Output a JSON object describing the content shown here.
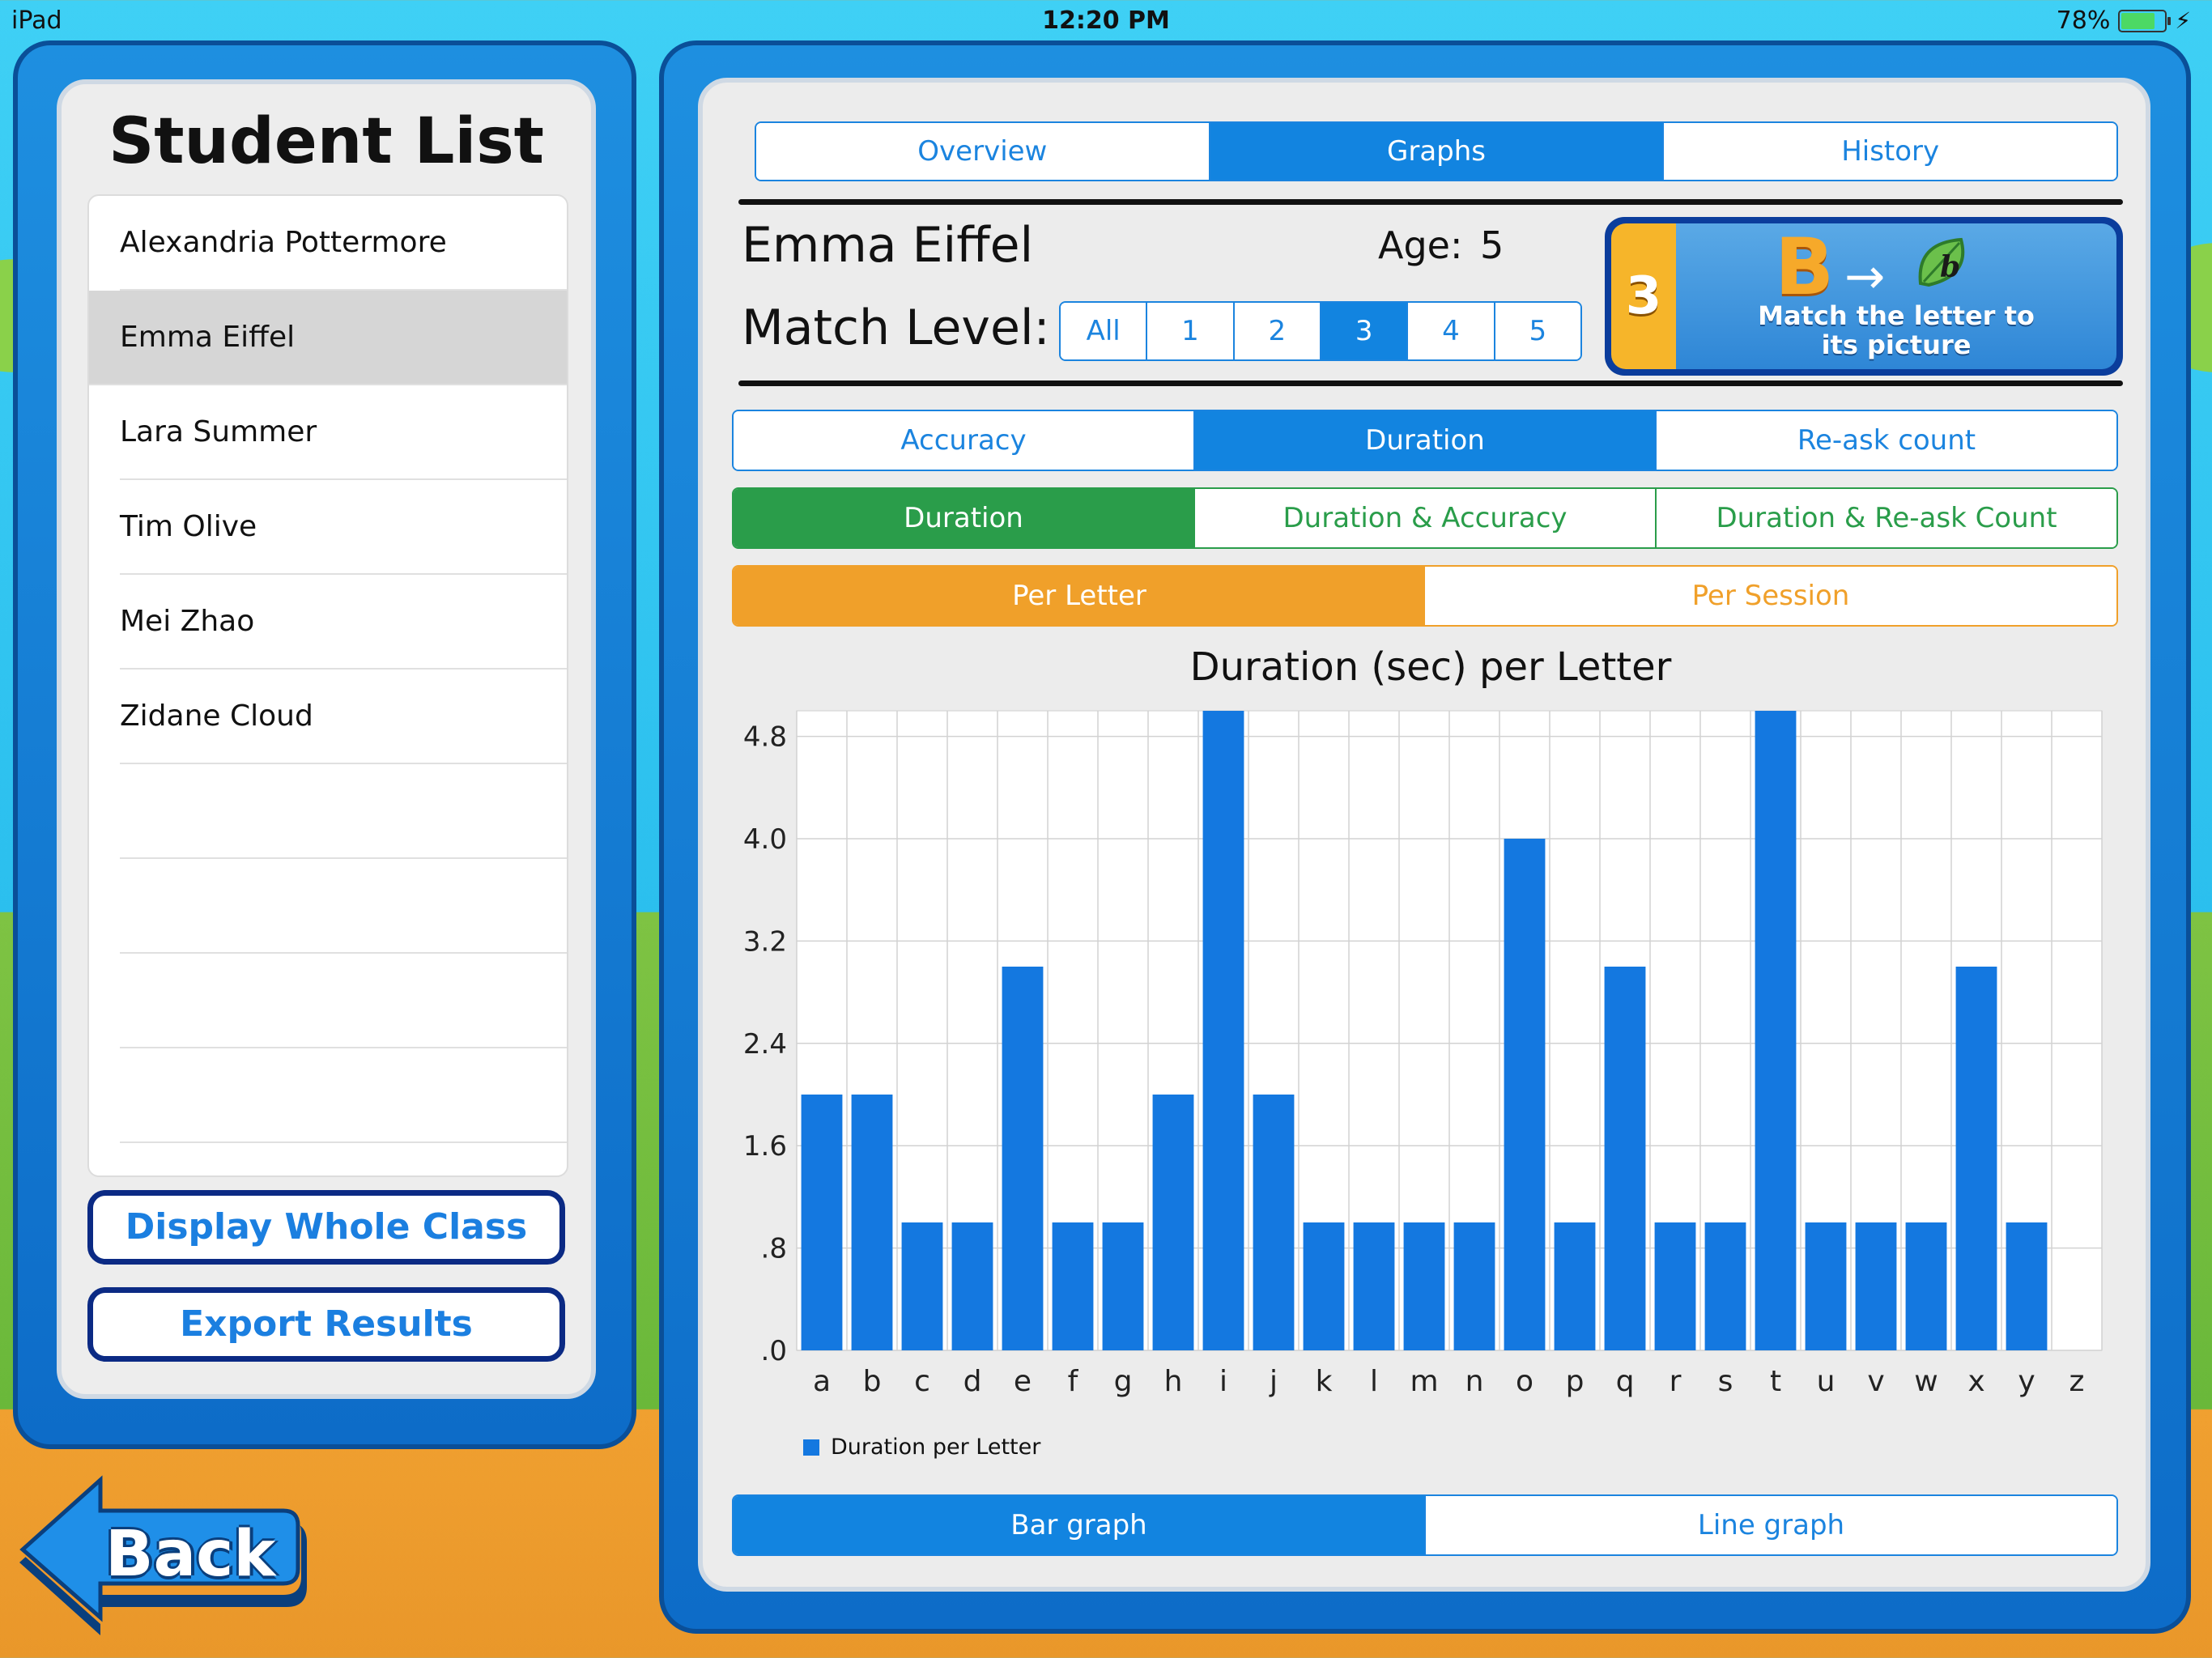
{
  "status_bar": {
    "device": "iPad",
    "time": "12:20 PM",
    "battery": "78%",
    "battery_level": 0.78
  },
  "sidebar": {
    "title": "Student List",
    "students": [
      {
        "name": "Alexandria Pottermore",
        "selected": false
      },
      {
        "name": "Emma Eiffel",
        "selected": true
      },
      {
        "name": "Lara Summer",
        "selected": false
      },
      {
        "name": "Tim Olive",
        "selected": false
      },
      {
        "name": "Mei Zhao",
        "selected": false
      },
      {
        "name": "Zidane Cloud",
        "selected": false
      },
      {
        "name": "",
        "selected": false
      },
      {
        "name": "",
        "selected": false
      },
      {
        "name": "",
        "selected": false
      },
      {
        "name": "",
        "selected": false
      }
    ],
    "display_class_label": "Display Whole Class",
    "export_label": "Export Results"
  },
  "back_label": "Back",
  "top_tabs": {
    "items": [
      "Overview",
      "Graphs",
      "History"
    ],
    "active": 1
  },
  "student": {
    "name": "Emma Eiffel",
    "age_label": "Age:",
    "age": "5"
  },
  "match_level": {
    "label": "Match Level:",
    "options": [
      "All",
      "1",
      "2",
      "3",
      "4",
      "5"
    ],
    "active": 3
  },
  "level_card": {
    "number": "3",
    "letter": "B",
    "description_line1": "Match the letter to",
    "description_line2": "its picture"
  },
  "metric_tabs": {
    "items": [
      "Accuracy",
      "Duration",
      "Re-ask count"
    ],
    "active": 1
  },
  "duration_tabs": {
    "items": [
      "Duration",
      "Duration & Accuracy",
      "Duration & Re-ask Count"
    ],
    "active": 0
  },
  "per_tabs": {
    "items": [
      "Per Letter",
      "Per Session"
    ],
    "active": 0
  },
  "graph_type_tabs": {
    "items": [
      "Bar graph",
      "Line graph"
    ],
    "active": 0
  },
  "colors": {
    "bar": "#1478e0",
    "tab_blue": "#1284e0",
    "tab_green": "#2a9d4a",
    "tab_orange": "#f0a02a",
    "frame_blue": "#0d6cc8"
  },
  "chart_data": {
    "type": "bar",
    "title": "Duration (sec) per Letter",
    "xlabel": "",
    "ylabel": "",
    "ylim": [
      0,
      5
    ],
    "yticks": [
      ".0",
      ".8",
      "1.6",
      "2.4",
      "3.2",
      "4.0",
      "4.8"
    ],
    "grid": true,
    "legend_position": "bottom-left",
    "categories": [
      "a",
      "b",
      "c",
      "d",
      "e",
      "f",
      "g",
      "h",
      "i",
      "j",
      "k",
      "l",
      "m",
      "n",
      "o",
      "p",
      "q",
      "r",
      "s",
      "t",
      "u",
      "v",
      "w",
      "x",
      "y",
      "z"
    ],
    "series": [
      {
        "name": "Duration per Letter",
        "values": [
          2,
          2,
          1,
          1,
          3,
          1,
          1,
          2,
          5,
          2,
          1,
          1,
          1,
          1,
          4,
          1,
          3,
          1,
          1,
          5,
          1,
          1,
          1,
          3,
          1,
          0
        ]
      }
    ]
  }
}
